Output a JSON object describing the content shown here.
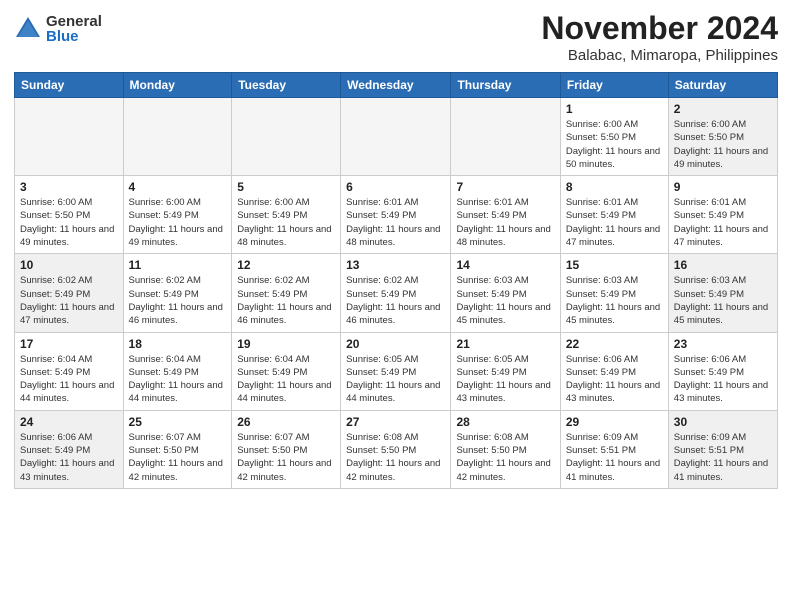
{
  "logo": {
    "general": "General",
    "blue": "Blue"
  },
  "header": {
    "month": "November 2024",
    "location": "Balabac, Mimaropa, Philippines"
  },
  "days_of_week": [
    "Sunday",
    "Monday",
    "Tuesday",
    "Wednesday",
    "Thursday",
    "Friday",
    "Saturday"
  ],
  "weeks": [
    [
      {
        "day": "",
        "empty": true
      },
      {
        "day": "",
        "empty": true
      },
      {
        "day": "",
        "empty": true
      },
      {
        "day": "",
        "empty": true
      },
      {
        "day": "",
        "empty": true
      },
      {
        "day": "1",
        "sunrise": "6:00 AM",
        "sunset": "5:50 PM",
        "daylight": "11 hours and 50 minutes."
      },
      {
        "day": "2",
        "sunrise": "6:00 AM",
        "sunset": "5:50 PM",
        "daylight": "11 hours and 49 minutes."
      }
    ],
    [
      {
        "day": "3",
        "sunrise": "6:00 AM",
        "sunset": "5:50 PM",
        "daylight": "11 hours and 49 minutes."
      },
      {
        "day": "4",
        "sunrise": "6:00 AM",
        "sunset": "5:49 PM",
        "daylight": "11 hours and 49 minutes."
      },
      {
        "day": "5",
        "sunrise": "6:00 AM",
        "sunset": "5:49 PM",
        "daylight": "11 hours and 48 minutes."
      },
      {
        "day": "6",
        "sunrise": "6:01 AM",
        "sunset": "5:49 PM",
        "daylight": "11 hours and 48 minutes."
      },
      {
        "day": "7",
        "sunrise": "6:01 AM",
        "sunset": "5:49 PM",
        "daylight": "11 hours and 48 minutes."
      },
      {
        "day": "8",
        "sunrise": "6:01 AM",
        "sunset": "5:49 PM",
        "daylight": "11 hours and 47 minutes."
      },
      {
        "day": "9",
        "sunrise": "6:01 AM",
        "sunset": "5:49 PM",
        "daylight": "11 hours and 47 minutes."
      }
    ],
    [
      {
        "day": "10",
        "sunrise": "6:02 AM",
        "sunset": "5:49 PM",
        "daylight": "11 hours and 47 minutes."
      },
      {
        "day": "11",
        "sunrise": "6:02 AM",
        "sunset": "5:49 PM",
        "daylight": "11 hours and 46 minutes."
      },
      {
        "day": "12",
        "sunrise": "6:02 AM",
        "sunset": "5:49 PM",
        "daylight": "11 hours and 46 minutes."
      },
      {
        "day": "13",
        "sunrise": "6:02 AM",
        "sunset": "5:49 PM",
        "daylight": "11 hours and 46 minutes."
      },
      {
        "day": "14",
        "sunrise": "6:03 AM",
        "sunset": "5:49 PM",
        "daylight": "11 hours and 45 minutes."
      },
      {
        "day": "15",
        "sunrise": "6:03 AM",
        "sunset": "5:49 PM",
        "daylight": "11 hours and 45 minutes."
      },
      {
        "day": "16",
        "sunrise": "6:03 AM",
        "sunset": "5:49 PM",
        "daylight": "11 hours and 45 minutes."
      }
    ],
    [
      {
        "day": "17",
        "sunrise": "6:04 AM",
        "sunset": "5:49 PM",
        "daylight": "11 hours and 44 minutes."
      },
      {
        "day": "18",
        "sunrise": "6:04 AM",
        "sunset": "5:49 PM",
        "daylight": "11 hours and 44 minutes."
      },
      {
        "day": "19",
        "sunrise": "6:04 AM",
        "sunset": "5:49 PM",
        "daylight": "11 hours and 44 minutes."
      },
      {
        "day": "20",
        "sunrise": "6:05 AM",
        "sunset": "5:49 PM",
        "daylight": "11 hours and 44 minutes."
      },
      {
        "day": "21",
        "sunrise": "6:05 AM",
        "sunset": "5:49 PM",
        "daylight": "11 hours and 43 minutes."
      },
      {
        "day": "22",
        "sunrise": "6:06 AM",
        "sunset": "5:49 PM",
        "daylight": "11 hours and 43 minutes."
      },
      {
        "day": "23",
        "sunrise": "6:06 AM",
        "sunset": "5:49 PM",
        "daylight": "11 hours and 43 minutes."
      }
    ],
    [
      {
        "day": "24",
        "sunrise": "6:06 AM",
        "sunset": "5:49 PM",
        "daylight": "11 hours and 43 minutes."
      },
      {
        "day": "25",
        "sunrise": "6:07 AM",
        "sunset": "5:50 PM",
        "daylight": "11 hours and 42 minutes."
      },
      {
        "day": "26",
        "sunrise": "6:07 AM",
        "sunset": "5:50 PM",
        "daylight": "11 hours and 42 minutes."
      },
      {
        "day": "27",
        "sunrise": "6:08 AM",
        "sunset": "5:50 PM",
        "daylight": "11 hours and 42 minutes."
      },
      {
        "day": "28",
        "sunrise": "6:08 AM",
        "sunset": "5:50 PM",
        "daylight": "11 hours and 42 minutes."
      },
      {
        "day": "29",
        "sunrise": "6:09 AM",
        "sunset": "5:51 PM",
        "daylight": "11 hours and 41 minutes."
      },
      {
        "day": "30",
        "sunrise": "6:09 AM",
        "sunset": "5:51 PM",
        "daylight": "11 hours and 41 minutes."
      }
    ]
  ]
}
